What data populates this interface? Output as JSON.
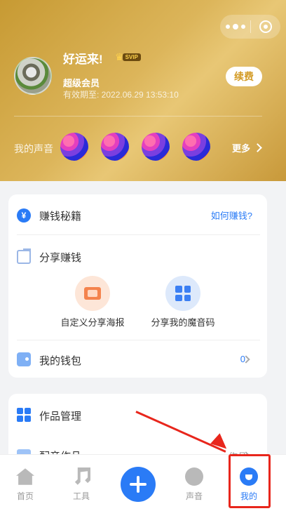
{
  "profile": {
    "greeting": "好运来!",
    "vip_tag": "SVIP",
    "member_type": "超级会员",
    "expiry_text": "有效期至: 2022.06.29 13:53:10",
    "renew_label": "续费"
  },
  "voices": {
    "label": "我的声音",
    "more_label": "更多"
  },
  "earn": {
    "title": "赚钱秘籍",
    "link": "如何赚钱?",
    "share_title": "分享赚钱",
    "options": [
      {
        "label": "自定义分享海报",
        "icon": "poster-icon"
      },
      {
        "label": "分享我的魔音码",
        "icon": "qr-code-icon"
      }
    ],
    "wallet_title": "我的钱包",
    "wallet_value": "0"
  },
  "works": {
    "title": "作品管理",
    "dub_title": "配音作品",
    "dub_right": "作品"
  },
  "tabbar": {
    "home": "首页",
    "tools": "工具",
    "sound": "声音",
    "mine": "我的"
  },
  "colors": {
    "accent": "#2a7bf6",
    "header_gold": "#dcb55a",
    "annotation_red": "#e8261c"
  }
}
